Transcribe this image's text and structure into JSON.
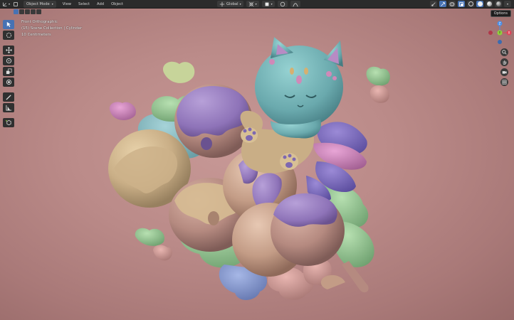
{
  "header": {
    "mode": "Object Mode",
    "menus": [
      "View",
      "Select",
      "Add",
      "Object"
    ],
    "transform_orientation": "Global",
    "options_label": "Options"
  },
  "viewport": {
    "view_name": "Front Orthographic",
    "collection": "(15) Scene Collection | Cylinder",
    "scale": "10 Centimeters"
  },
  "gizmo": {
    "x_color": "#e0445a",
    "y_color": "#8ed23a",
    "z_color": "#4d8fe6",
    "x_label": "X",
    "y_label": "Y",
    "z_label": "Z"
  },
  "icons": {
    "editor_type": "axis-icon",
    "select": "cursor-icon",
    "cursor": "circle-cursor-icon",
    "move": "move-icon",
    "rotate": "rotate-icon",
    "scale": "scale-icon",
    "transform": "transform-icon",
    "annotate": "annotate-icon",
    "measure": "measure-icon",
    "add_cube": "add-cube-icon",
    "zoom": "zoom-icon",
    "pan": "hand-icon",
    "camera": "camera-icon",
    "grid": "grid-icon"
  },
  "colors": {
    "background": "#bb8b89",
    "accent": "#4772b3",
    "header": "#2b2b2b"
  }
}
